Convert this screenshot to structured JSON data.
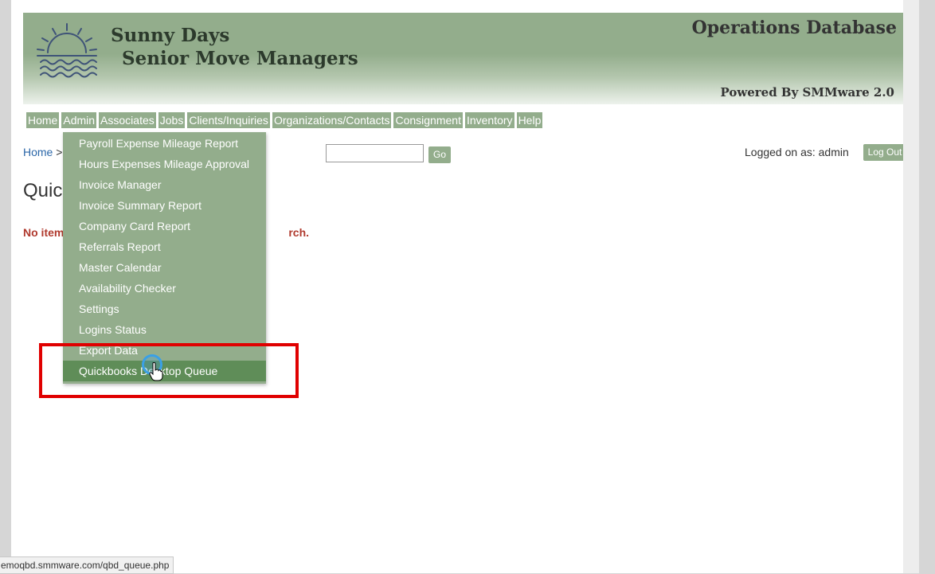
{
  "header": {
    "company_line1": "Sunny Days",
    "company_line2": "Senior Move Managers",
    "ops_title": "Operations Database",
    "powered_by": "Powered By SMMware 2.0"
  },
  "nav": {
    "items": [
      "Home",
      "Admin",
      "Associates",
      "Jobs",
      "Clients/Inquiries",
      "Organizations/Contacts",
      "Consignment",
      "Inventory",
      "Help"
    ]
  },
  "breadcrumb": {
    "home": "Home",
    "separator": ">"
  },
  "search": {
    "value": "",
    "go_label": "Go"
  },
  "session": {
    "logged_on": "Logged on as: admin",
    "logout_label": "Log Out"
  },
  "main": {
    "title": "Quickbooks Desktop Queue",
    "message_start": "No item",
    "message_end": "rch."
  },
  "admin_menu": {
    "items": [
      "Payroll Expense Mileage Report",
      "Hours Expenses Mileage Approval",
      "Invoice Manager",
      "Invoice Summary Report",
      "Company Card Report",
      "Referrals Report",
      "Master Calendar",
      "Availability Checker",
      "Settings",
      "Logins Status",
      "Export Data",
      "Quickbooks Desktop Queue"
    ],
    "active_index": 11
  },
  "status_bar": {
    "url": "emoqbd.smmware.com/qbd_queue.php"
  },
  "colors": {
    "accent": "#93ad8c",
    "active": "#5f8d58",
    "highlight": "#e00000",
    "error": "#b03a2e"
  },
  "icons": {
    "logo": "sun-over-water-logo",
    "cursor": "hand-pointer-icon"
  }
}
